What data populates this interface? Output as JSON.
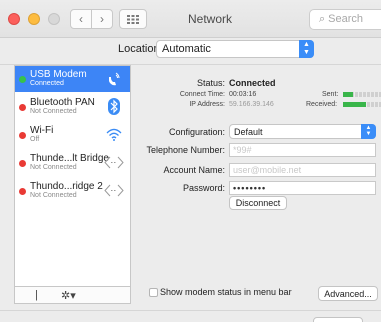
{
  "window": {
    "title": "Network",
    "search_placeholder": "Search"
  },
  "location": {
    "label": "Location:",
    "value": "Automatic"
  },
  "services": [
    {
      "name": "USB Modem",
      "status": "Connected",
      "indicator": "green",
      "icon": "phone-signal-icon",
      "selected": true
    },
    {
      "name": "Bluetooth PAN",
      "status": "Not Connected",
      "indicator": "red",
      "icon": "bluetooth-icon",
      "selected": false
    },
    {
      "name": "Wi-Fi",
      "status": "Off",
      "indicator": "red",
      "icon": "wifi-icon",
      "selected": false
    },
    {
      "name": "Thunde...lt Bridge",
      "status": "Not Connected",
      "indicator": "red",
      "icon": "thunderbolt-arrows-icon",
      "selected": false
    },
    {
      "name": "Thundo...ridge 2",
      "status": "Not Connected",
      "indicator": "red",
      "icon": "thunderbolt-arrows-icon",
      "selected": false
    }
  ],
  "sidebar_footer": {
    "add_remove": "|",
    "gear": "✲▾"
  },
  "detail": {
    "status_label": "Status:",
    "status_value": "Connected",
    "connect_time_label": "Connect Time:",
    "connect_time_value": "00:03:16",
    "ip_label": "IP Address:",
    "ip_value": "59.166.39.146",
    "sent_label": "Sent:",
    "received_label": "Received:",
    "sent_level": 0.25,
    "received_level": 0.6,
    "configuration_label": "Configuration:",
    "configuration_value": "Default",
    "telephone_label": "Telephone Number:",
    "telephone_value": "*99#",
    "account_label": "Account Name:",
    "account_value": "user@mobile.net",
    "password_label": "Password:",
    "password_value": "••••••••",
    "disconnect_label": "Disconnect",
    "modem_status_checkbox_label": "Show modem status in menu bar",
    "advanced_label": "Advanced..."
  },
  "colors": {
    "selection": "#3d85f6",
    "connected": "#37c24b",
    "disconnected": "#e93a35"
  }
}
